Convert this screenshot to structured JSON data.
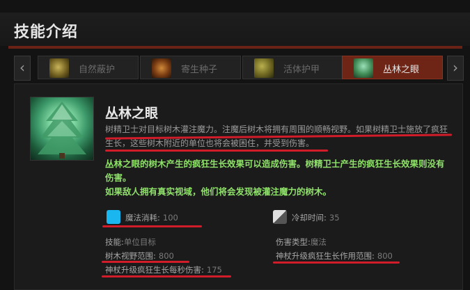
{
  "header": {
    "title": "技能介绍"
  },
  "tabs": [
    {
      "label": "自然蔽护",
      "icon": "nature-guise-icon"
    },
    {
      "label": "寄生种子",
      "icon": "leech-seed-icon"
    },
    {
      "label": "活体护甲",
      "icon": "living-armor-icon"
    },
    {
      "label": "丛林之眼",
      "icon": "eyes-in-the-forest-icon",
      "active": true
    }
  ],
  "skill": {
    "name": "丛林之眼",
    "description": "树精卫士对目标树木灌注魔力。注魔后树木将拥有周围的顺畅视野。如果树精卫士施放了疯狂生长，这些树木附近的单位也将会被困住，并受到伤害。",
    "note_line1": "丛林之眼的树木产生的疯狂生长效果可以造成伤害。树精卫士产生的疯狂生长效果则没有伤害。",
    "note_line2": "如果敌人拥有真实视域，他们将会发现被灌注魔力的树木。",
    "mana_label": "魔法消耗:",
    "mana_value": "100",
    "cooldown_label": "冷却时间:",
    "cooldown_value": "35",
    "ability_label": "技能:",
    "ability_value": "单位目标",
    "damage_type_label": "伤害类型:",
    "damage_type_value": "魔法",
    "tree_vision_label": "树木视野范围:",
    "tree_vision_value": "800",
    "overgrowth_dps_label": "神杖升级疯狂生长每秒伤害:",
    "overgrowth_dps_value": "175",
    "overgrowth_range_label": "神杖升级疯狂生长作用范围:",
    "overgrowth_range_value": "800"
  },
  "colors": {
    "accent": "#6e2516",
    "note": "#8fe16a",
    "mana": "#19b6f0",
    "annotation": "#d21c2a"
  }
}
